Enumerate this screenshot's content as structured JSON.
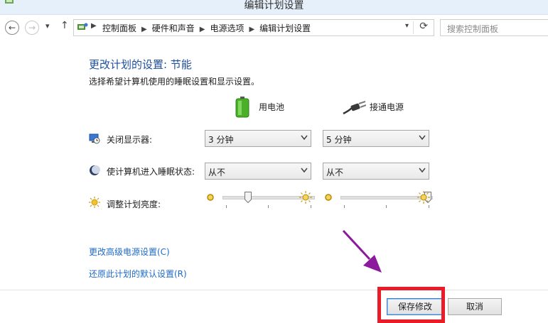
{
  "window": {
    "title": "编辑计划设置"
  },
  "nav": {
    "back_icon": "back-arrow-icon",
    "forward_icon": "forward-arrow-icon",
    "breadcrumb": [
      "控制面板",
      "硬件和声音",
      "电源选项",
      "编辑计划设置"
    ],
    "search_placeholder": "搜索控制面板"
  },
  "main": {
    "heading": "更改计划的设置: 节能",
    "subheading": "选择希望计算机使用的睡眠设置和显示设置。",
    "columns": {
      "battery": "用电池",
      "plugged": "接通电源"
    },
    "rows": [
      {
        "label": "关闭显示器:",
        "battery": "3 分钟",
        "plugged": "5 分钟"
      },
      {
        "label": "使计算机进入睡眠状态:",
        "battery": "从不",
        "plugged": "从不"
      }
    ],
    "brightness": {
      "label": "调整计划亮度:",
      "battery_level": 0.25,
      "plugged_level": 1.0
    },
    "links": {
      "advanced": "更改高级电源设置(C)",
      "restore": "还原此计划的默认设置(R)"
    }
  },
  "footer": {
    "save": "保存修改",
    "cancel": "取消"
  },
  "colors": {
    "heading": "#1e4f9a",
    "link": "#1e6ac8",
    "highlight": "#ea1c2a",
    "annotation_arrow": "#8b1a9c"
  }
}
